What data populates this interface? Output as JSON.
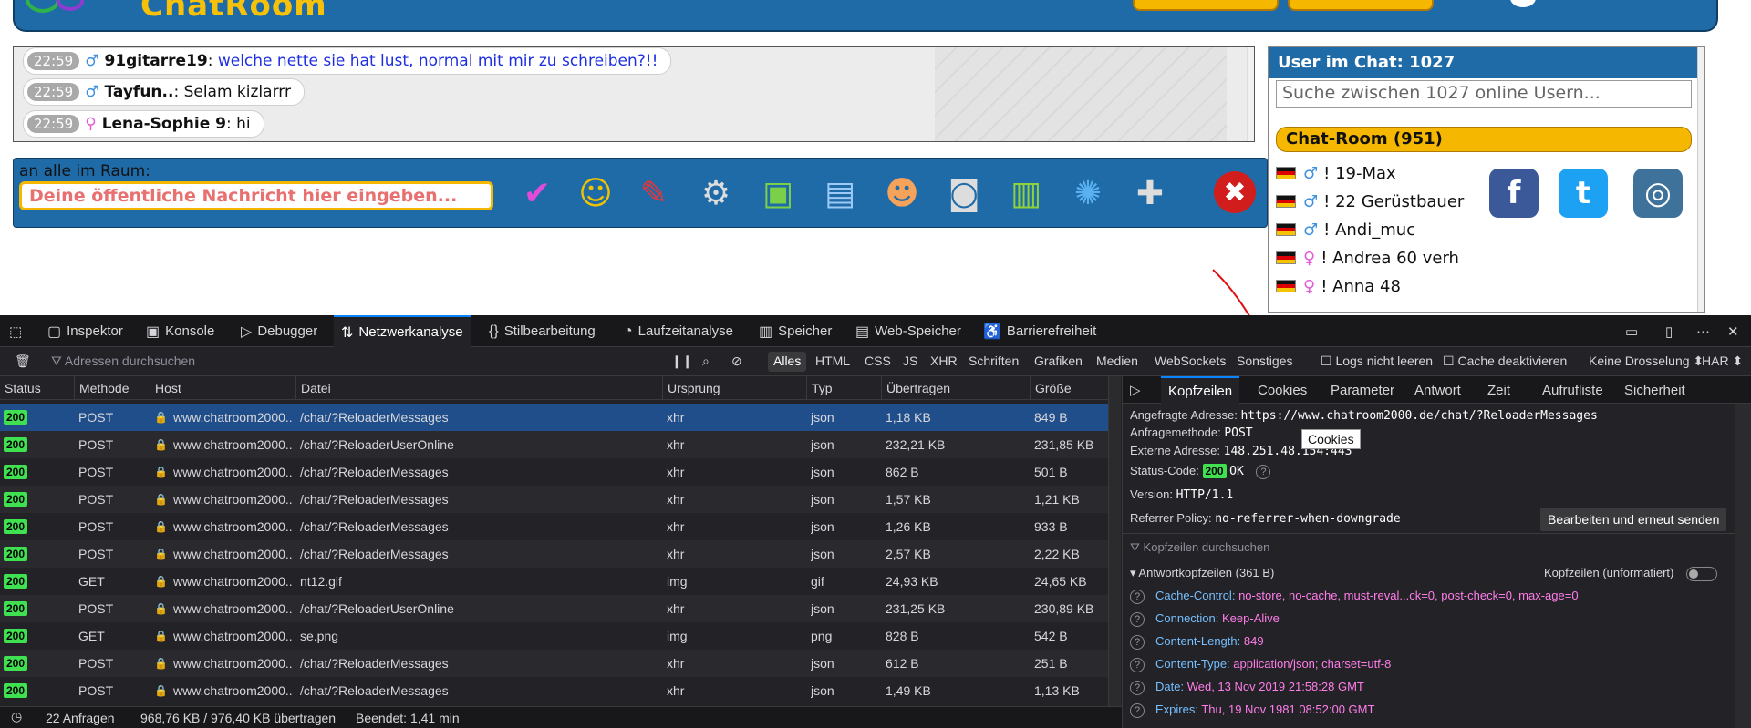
{
  "chat": {
    "messages": [
      {
        "time": "22:59",
        "gender": "male",
        "nick": "91gitarre19",
        "text": "welche nette sie hat lust, normal mit mir zu schreiben?!!"
      },
      {
        "time": "22:59",
        "gender": "male",
        "nick": "Tayfun..",
        "text": "Selam kizlarrr"
      },
      {
        "time": "22:59",
        "gender": "female",
        "nick": "Lena-Sophie 9",
        "text": "hi"
      }
    ],
    "room_label": "an alle im Raum:",
    "input_placeholder": "Deine öffentliche Nachricht hier eingeben..."
  },
  "userpanel": {
    "title": "User im Chat: 1027",
    "search_placeholder": "Suche zwischen 1027 online Usern...",
    "room": "Chat-Room (951)",
    "users": [
      "! 19-Max",
      "! 22 Gerüstbauer",
      "! Andi_muc",
      "! Andrea 60 verh",
      "! Anna 48"
    ],
    "user_genders": [
      "male",
      "male",
      "male",
      "female",
      "female"
    ]
  },
  "devtools": {
    "tabs": [
      "Inspektor",
      "Konsole",
      "Debugger",
      "Netzwerkanalyse",
      "Stilbearbeitung",
      "Laufzeitanalyse",
      "Speicher",
      "Web-Speicher",
      "Barrierefreiheit"
    ],
    "filter_placeholder": "Adressen durchsuchen",
    "type_filters": [
      "Alles",
      "HTML",
      "CSS",
      "JS",
      "XHR",
      "Schriften",
      "Grafiken",
      "Medien",
      "WebSockets",
      "Sonstiges"
    ],
    "logs_label": "Logs nicht leeren",
    "cache_label": "Cache deaktivieren",
    "throttle": "Keine Drosselung ⬍",
    "har": "HAR ⬍",
    "columns": [
      "Status",
      "Methode",
      "Host",
      "Datei",
      "Ursprung",
      "Typ",
      "Übertragen",
      "Größe"
    ],
    "requests": [
      {
        "status": "200",
        "method": "POST",
        "host": "www.chatroom2000...",
        "file": "/chat/?ReloaderMessages",
        "origin": "xhr",
        "type": "json",
        "transferred": "1,18 KB",
        "size": "849 B"
      },
      {
        "status": "200",
        "method": "POST",
        "host": "www.chatroom2000...",
        "file": "/chat/?ReloaderUserOnline",
        "origin": "xhr",
        "type": "json",
        "transferred": "232,21 KB",
        "size": "231,85 KB"
      },
      {
        "status": "200",
        "method": "POST",
        "host": "www.chatroom2000...",
        "file": "/chat/?ReloaderMessages",
        "origin": "xhr",
        "type": "json",
        "transferred": "862 B",
        "size": "501 B"
      },
      {
        "status": "200",
        "method": "POST",
        "host": "www.chatroom2000...",
        "file": "/chat/?ReloaderMessages",
        "origin": "xhr",
        "type": "json",
        "transferred": "1,57 KB",
        "size": "1,21 KB"
      },
      {
        "status": "200",
        "method": "POST",
        "host": "www.chatroom2000...",
        "file": "/chat/?ReloaderMessages",
        "origin": "xhr",
        "type": "json",
        "transferred": "1,26 KB",
        "size": "933 B"
      },
      {
        "status": "200",
        "method": "POST",
        "host": "www.chatroom2000...",
        "file": "/chat/?ReloaderMessages",
        "origin": "xhr",
        "type": "json",
        "transferred": "2,57 KB",
        "size": "2,22 KB"
      },
      {
        "status": "200",
        "method": "GET",
        "host": "www.chatroom2000...",
        "file": "nt12.gif",
        "origin": "img",
        "type": "gif",
        "transferred": "24,93 KB",
        "size": "24,65 KB"
      },
      {
        "status": "200",
        "method": "POST",
        "host": "www.chatroom2000...",
        "file": "/chat/?ReloaderUserOnline",
        "origin": "xhr",
        "type": "json",
        "transferred": "231,25 KB",
        "size": "230,89 KB"
      },
      {
        "status": "200",
        "method": "GET",
        "host": "www.chatroom2000...",
        "file": "se.png",
        "origin": "img",
        "type": "png",
        "transferred": "828 B",
        "size": "542 B"
      },
      {
        "status": "200",
        "method": "POST",
        "host": "www.chatroom2000...",
        "file": "/chat/?ReloaderMessages",
        "origin": "xhr",
        "type": "json",
        "transferred": "612 B",
        "size": "251 B"
      },
      {
        "status": "200",
        "method": "POST",
        "host": "www.chatroom2000...",
        "file": "/chat/?ReloaderMessages",
        "origin": "xhr",
        "type": "json",
        "transferred": "1,49 KB",
        "size": "1,13 KB"
      }
    ],
    "statusbar": {
      "requests": "22 Anfragen",
      "transferred": "968,76 KB / 976,40 KB übertragen",
      "finished": "Beendet: 1,41 min"
    },
    "side_tabs": [
      "Kopfzeilen",
      "Cookies",
      "Parameter",
      "Antwort",
      "Zeit",
      "Aufrufliste",
      "Sicherheit"
    ],
    "details": {
      "url_label": "Angefragte Adresse:",
      "url": "https://www.chatroom2000.de/chat/?ReloaderMessages",
      "method_label": "Anfragemethode:",
      "method": "POST",
      "remote_label": "Externe Adresse:",
      "remote": "148.251.48.154:443",
      "status_label": "Status-Code:",
      "status_badge": "200",
      "status_text": "OK",
      "version_label": "Version:",
      "version": "HTTP/1.1",
      "referrer_label": "Referrer Policy:",
      "referrer": "no-referrer-when-downgrade",
      "tooltip": "Cookies",
      "resend": "Bearbeiten und erneut senden",
      "filter_placeholder": "Kopfzeilen durchsuchen",
      "response_headers": "Antwortkopfzeilen (361 B)",
      "raw_toggle": "Kopfzeilen (unformatiert)",
      "headers": [
        {
          "name": "Cache-Control:",
          "value": "no-store, no-cache, must-reval...ck=0, post-check=0, max-age=0"
        },
        {
          "name": "Connection:",
          "value": "Keep-Alive"
        },
        {
          "name": "Content-Length:",
          "value": "849"
        },
        {
          "name": "Content-Type:",
          "value": "application/json; charset=utf-8"
        },
        {
          "name": "Date:",
          "value": "Wed, 13 Nov 2019 21:58:28 GMT"
        },
        {
          "name": "Expires:",
          "value": "Thu, 19 Nov 1981 08:52:00 GMT"
        }
      ]
    }
  },
  "colors": {
    "accent": "#0a84ff",
    "status_ok": "#3fe150",
    "chat_blue": "#1f6ba8",
    "chat_yellow": "#f5b700"
  }
}
